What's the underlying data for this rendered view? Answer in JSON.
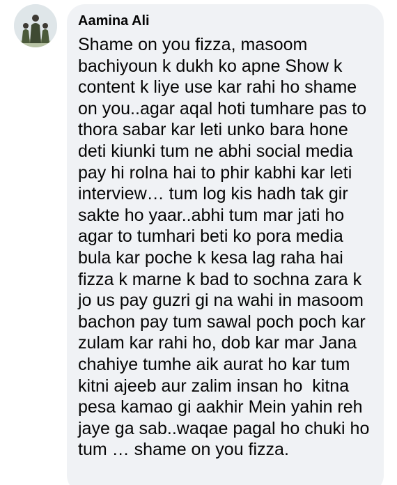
{
  "comment": {
    "author": "Aamina Ali",
    "avatar_icon": "profile-photo-icon",
    "lines": [
      "Shame on you fizza, masoom",
      "bachiyoun k dukh ko apne Show k",
      "content k liye use kar rahi ho shame",
      "on you..agar aqal hoti tumhare pas to",
      "thora sabar kar leti unko bara hone",
      "deti kiunki tum ne abhi social media",
      "pay hi rolna hai to phir kabhi kar leti",
      "interview… tum log kis hadh tak gir",
      "sakte ho yaar..abhi tum mar jati ho",
      "agar to tumhari beti ko pora media",
      "bula kar poche k kesa lag raha hai",
      "fizza k marne k bad to sochna zara k",
      "jo us pay guzri gi na wahi in masoom",
      "bachon pay tum sawal poch poch kar",
      "zulam kar rahi ho, dob kar mar Jana",
      "chahiye tumhe aik aurat ho kar tum",
      "kitni ajeeb aur zalim insan ho  kitna",
      "pesa kamao gi aakhir Mein yahin reh",
      "jaye ga sab..waqae pagal ho chuki ho",
      "tum … shame on you fizza."
    ]
  },
  "colors": {
    "bubble_bg": "#f0f2f5",
    "text": "#050505"
  }
}
